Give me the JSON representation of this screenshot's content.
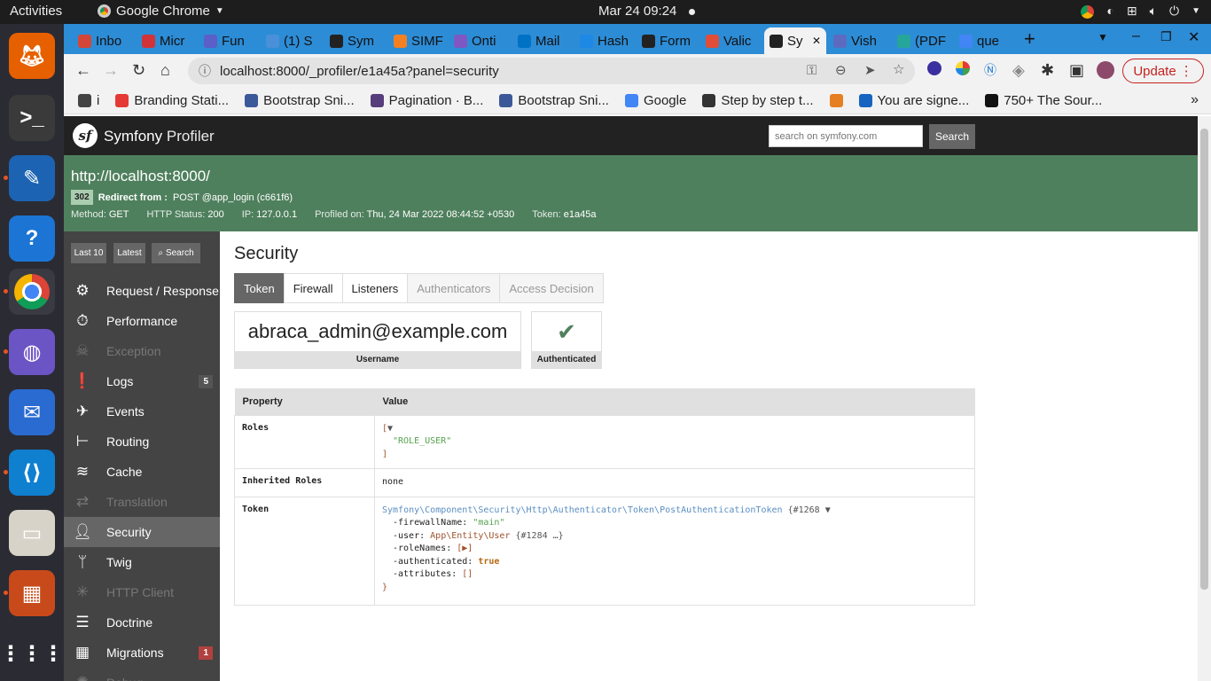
{
  "system": {
    "activities": "Activities",
    "app_name": "Google Chrome",
    "clock": "Mar 24  09:24"
  },
  "dock": {
    "apps": [
      {
        "name": "firefox",
        "color": "#e66000"
      },
      {
        "name": "terminal",
        "color": "#3a3a3a"
      },
      {
        "name": "writer",
        "color": "#1c64b3"
      },
      {
        "name": "help",
        "color": "#1c74d4"
      },
      {
        "name": "chrome",
        "color": "#dadada"
      },
      {
        "name": "web",
        "color": "#6b54c4"
      },
      {
        "name": "thunderbird",
        "color": "#2a6bd1"
      },
      {
        "name": "vscode",
        "color": "#0f7fd0"
      },
      {
        "name": "files",
        "color": "#d8d3c8"
      },
      {
        "name": "impress",
        "color": "#c84a1a"
      },
      {
        "name": "apps-grid",
        "color": "#2b2b33"
      }
    ]
  },
  "browser": {
    "tabs": [
      {
        "label": "Inbo",
        "color": "#d44638"
      },
      {
        "label": "Micr",
        "color": "#d13438"
      },
      {
        "label": "Fun",
        "color": "#5b5fc7"
      },
      {
        "label": "(1) S",
        "color": "#4a90d9"
      },
      {
        "label": "Sym",
        "color": "#222222"
      },
      {
        "label": "SIMF",
        "color": "#f48024"
      },
      {
        "label": "Onti",
        "color": "#7e57c2"
      },
      {
        "label": "Mail",
        "color": "#0072c6"
      },
      {
        "label": "Hash",
        "color": "#1e88e5"
      },
      {
        "label": "Form",
        "color": "#222222"
      },
      {
        "label": "Valic",
        "color": "#e04e39"
      },
      {
        "label": "Sy",
        "color": "#222222"
      },
      {
        "label": "Vish",
        "color": "#5c6bc0"
      },
      {
        "label": "(PDF",
        "color": "#26a69a"
      },
      {
        "label": "que",
        "color": "#4285f4"
      }
    ],
    "active_tab": 11,
    "url": "localhost:8000/_profiler/e1a45a?panel=security",
    "update_label": "Update",
    "bookmarks": [
      {
        "label": "i",
        "color": "#444444"
      },
      {
        "label": "Branding Stati...",
        "color": "#e53935"
      },
      {
        "label": "Bootstrap Sni...",
        "color": "#3b5998"
      },
      {
        "label": "Pagination · B...",
        "color": "#563d7c"
      },
      {
        "label": "Bootstrap Sni...",
        "color": "#3b5998"
      },
      {
        "label": "Google",
        "color": "#4285f4"
      },
      {
        "label": "Step by step t...",
        "color": "#333333"
      },
      {
        "label": "",
        "color": "#e67e22"
      },
      {
        "label": "You are signe...",
        "color": "#1565c0"
      },
      {
        "label": "750+ The Sour...",
        "color": "#111111"
      }
    ]
  },
  "profiler": {
    "brand_symfony": "Symfony",
    "brand_profiler": "Profiler",
    "search_placeholder": "search on symfony.com",
    "search_button": "Search",
    "summary": {
      "url": "http://localhost:8000/",
      "status_badge": "302",
      "redirect_label": "Redirect from :",
      "redirect_value": "POST @app_login (c661f6)",
      "method_label": "Method:",
      "method_value": "GET",
      "http_status_label": "HTTP Status:",
      "http_status_value": "200",
      "ip_label": "IP:",
      "ip_value": "127.0.0.1",
      "profiled_label": "Profiled on:",
      "profiled_value": "Thu, 24 Mar 2022 08:44:52 +0530",
      "token_label": "Token:",
      "token_value": "e1a45a"
    },
    "sidebar_buttons": [
      "Last 10",
      "Latest",
      "Search"
    ],
    "menu": [
      {
        "label": "Request / Response",
        "icon": "gears-icon",
        "state": "normal",
        "count": ""
      },
      {
        "label": "Performance",
        "icon": "stopwatch-icon",
        "state": "normal",
        "count": ""
      },
      {
        "label": "Exception",
        "icon": "ghost-icon",
        "state": "disabled",
        "count": ""
      },
      {
        "label": "Logs",
        "icon": "alert-icon",
        "state": "normal",
        "count": "5"
      },
      {
        "label": "Events",
        "icon": "satellite-icon",
        "state": "normal",
        "count": ""
      },
      {
        "label": "Routing",
        "icon": "signpost-icon",
        "state": "normal",
        "count": ""
      },
      {
        "label": "Cache",
        "icon": "layers-icon",
        "state": "normal",
        "count": ""
      },
      {
        "label": "Translation",
        "icon": "translate-icon",
        "state": "disabled",
        "count": ""
      },
      {
        "label": "Security",
        "icon": "user-icon",
        "state": "selected",
        "count": ""
      },
      {
        "label": "Twig",
        "icon": "twig-icon",
        "state": "normal",
        "count": ""
      },
      {
        "label": "HTTP Client",
        "icon": "network-icon",
        "state": "disabled",
        "count": ""
      },
      {
        "label": "Doctrine",
        "icon": "database-icon",
        "state": "normal",
        "count": ""
      },
      {
        "label": "Migrations",
        "icon": "migrations-icon",
        "state": "normal",
        "count": "1"
      },
      {
        "label": "Debug",
        "icon": "bug-icon",
        "state": "disabled",
        "count": ""
      }
    ],
    "content": {
      "title": "Security",
      "tabs": [
        {
          "label": "Token",
          "state": "active"
        },
        {
          "label": "Firewall",
          "state": "normal"
        },
        {
          "label": "Listeners",
          "state": "normal"
        },
        {
          "label": "Authenticators",
          "state": "disabled"
        },
        {
          "label": "Access Decision",
          "state": "disabled"
        }
      ],
      "username_value": "abraca_admin@example.com",
      "username_label": "Username",
      "authenticated_label": "Authenticated",
      "table_headers": [
        "Property",
        "Value"
      ],
      "roles_label": "Roles",
      "roles_value": "\"ROLE_USER\"",
      "inherited_label": "Inherited Roles",
      "inherited_value": "none",
      "token_label": "Token",
      "token_class": "Symfony\\Component\\Security\\Http\\Authenticator\\Token\\PostAuthenticationToken",
      "token_ref": "{#1268 ▼",
      "firewall_name_key": "-firewallName: ",
      "firewall_name_value": "\"main\"",
      "user_key": "-user: ",
      "user_class": "App\\Entity\\User",
      "user_ref": "{#1284 …}",
      "role_names_key": "-roleNames: ",
      "role_names_value": "[▶]",
      "authenticated_key": "-authenticated: ",
      "authenticated_value": "true",
      "attributes_key": "-attributes: ",
      "attributes_value": "[]"
    }
  }
}
